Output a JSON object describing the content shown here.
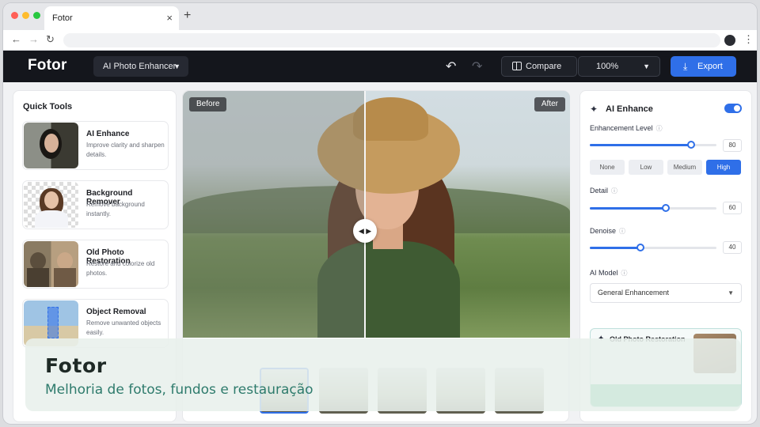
{
  "browser": {
    "tab_title": "Fotor",
    "tab_close": "×",
    "new_tab": "+",
    "back": "←",
    "forward": "→",
    "reload": "↻",
    "menu": "⋮"
  },
  "toolbar": {
    "logo": "Fotor",
    "tool_select": "AI Photo Enhancer",
    "compare_label": "Compare",
    "zoom_value": "100%",
    "export_label": "Export",
    "undo_icon": "↶",
    "redo_icon": "↷",
    "export_icon": "⤓"
  },
  "quick_tools": {
    "title": "Quick Tools",
    "items": [
      {
        "name": "AI Enhance",
        "desc": "Improve clarity and sharpen details."
      },
      {
        "name": "Background Remover",
        "desc": "Remove background instantly."
      },
      {
        "name": "Old Photo Restoration",
        "desc": "Restore and colorize old photos."
      },
      {
        "name": "Object Removal",
        "desc": "Remove unwanted objects easily."
      }
    ]
  },
  "canvas": {
    "before_label": "Before",
    "after_label": "After",
    "handle_icon": "◀ ▶"
  },
  "settings": {
    "title": "AI Enhance",
    "enabled": true,
    "enhancement_label": "Enhancement Level",
    "enhancement_value": "80",
    "enhancement_level": 0.8,
    "levels": [
      "None",
      "Low",
      "Medium",
      "High"
    ],
    "selected_level": "High",
    "detail_label": "Detail",
    "detail_value": "60",
    "detail_level": 0.6,
    "denoise_label": "Denoise",
    "denoise_value": "40",
    "denoise_level": 0.4,
    "model_label": "AI Model",
    "model_value": "General Enhancement",
    "info_icon": "ⓘ",
    "restore_title": "Old Photo Restoration"
  },
  "overlay": {
    "title": "Fotor",
    "subtitle": "Melhoria de fotos, fundos e restauração"
  },
  "colors": {
    "accent": "#2f6fe8",
    "topbar": "#14161c",
    "restore_button": "#42b883"
  }
}
